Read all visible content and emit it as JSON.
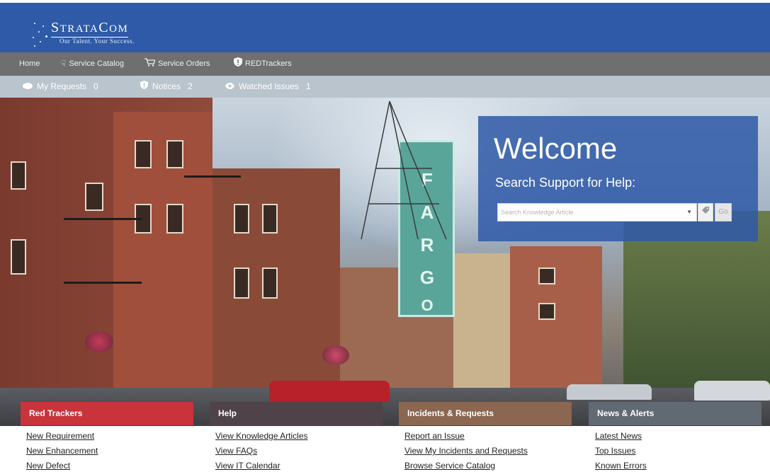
{
  "brand": {
    "name_first": "S",
    "name_mid": "TRATA",
    "name_c": "C",
    "name_end": "OM",
    "tagline": "Our Talent. Your Success."
  },
  "nav": {
    "items": [
      {
        "label": "Home",
        "icon": "none"
      },
      {
        "label": "Service Catalog",
        "icon": "hand-pointer-icon"
      },
      {
        "label": "Service Orders",
        "icon": "cart-icon"
      },
      {
        "label": "REDTrackers",
        "icon": "shield-icon"
      }
    ]
  },
  "status": {
    "my_requests": {
      "label": "My Requests",
      "count": "0",
      "icon": "dot-icon"
    },
    "notices": {
      "label": "Notices",
      "count": "2",
      "icon": "shield-icon"
    },
    "watched": {
      "label": "Watched Issues",
      "count": "1",
      "icon": "eye-icon"
    }
  },
  "welcome": {
    "title": "Welcome",
    "subtitle": "Search Support for Help:",
    "search_placeholder": "Search Knowledge Article",
    "go_label": "Go"
  },
  "hero": {
    "sign_letters": [
      "F",
      "A",
      "R",
      "G",
      "O"
    ]
  },
  "categories": [
    {
      "title": "Red Trackers",
      "color": "#c9333c",
      "links": [
        "New Requirement",
        "New Enhancement",
        "New Defect"
      ]
    },
    {
      "title": "Help",
      "color": "#4f4349",
      "links": [
        "View Knowledge Articles",
        "View FAQs",
        "View IT Calendar"
      ]
    },
    {
      "title": "Incidents & Requests",
      "color": "#8b6650",
      "links": [
        "Report an Issue",
        "View My Incidents and Requests",
        "Browse Service Catalog"
      ]
    },
    {
      "title": "News & Alerts",
      "color": "#616a72",
      "links": [
        "Latest News",
        "Top Issues",
        "Known Errors"
      ]
    }
  ],
  "colors": {
    "header_blue": "#2e5aa7",
    "nav_gray": "#6f6f6f",
    "status_bar": "#b9c4cd"
  }
}
